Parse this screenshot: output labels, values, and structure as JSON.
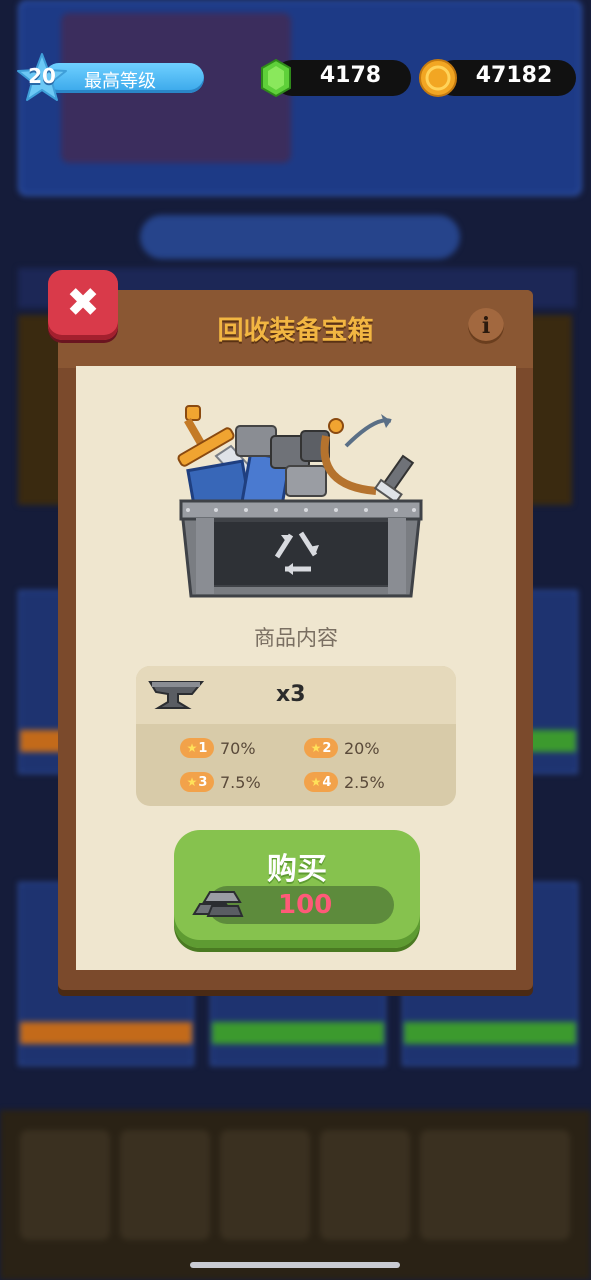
{
  "hud": {
    "level": "20",
    "level_label": "最高等级",
    "gems": "4178",
    "coins": "47182"
  },
  "modal": {
    "title": "回收装备宝箱",
    "info_icon": "info-icon",
    "close_icon": "close-icon",
    "contents_label": "商品内容",
    "item": {
      "icon": "anvil-icon",
      "quantity": "x3"
    },
    "drop_rates": [
      {
        "stars": "1",
        "rate": "70%"
      },
      {
        "stars": "2",
        "rate": "20%"
      },
      {
        "stars": "3",
        "rate": "7.5%"
      },
      {
        "stars": "4",
        "rate": "2.5%"
      }
    ],
    "buy": {
      "label": "购买",
      "price": "100",
      "currency_icon": "iron-ingot-icon"
    }
  },
  "colors": {
    "title": "#f2b642",
    "buy_button": "#86c24e",
    "price": "#ff5a78",
    "close_button": "#d93a4a"
  }
}
